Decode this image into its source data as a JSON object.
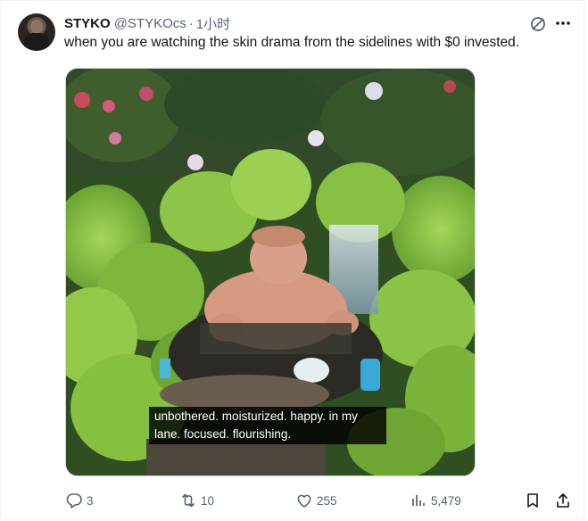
{
  "tweet": {
    "author_name": "STYKO",
    "author_handle": "@STYKOcs",
    "separator": "·",
    "timestamp": "1小时",
    "text": "when you are watching the skin drama from the sidelines with $0 invested.",
    "media": {
      "caption_line1": "unbothered. moisturized. happy. in my",
      "caption_line2": "lane. focused. flourishing."
    },
    "actions": {
      "replies": "3",
      "reposts": "10",
      "likes": "255",
      "views": "5,479"
    },
    "icons": {
      "grok": "grok-icon",
      "more": "more-icon",
      "reply": "reply-icon",
      "repost": "repost-icon",
      "like": "heart-icon",
      "views": "views-icon",
      "bookmark": "bookmark-icon",
      "share": "share-icon"
    },
    "colors": {
      "text": "#0f1419",
      "secondary": "#536471",
      "border": "#cfd9de"
    }
  }
}
